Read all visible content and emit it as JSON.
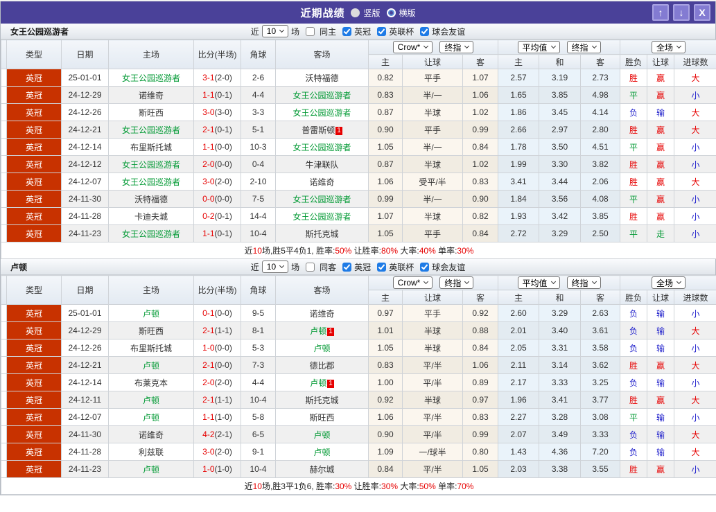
{
  "titlebar": {
    "title": "近期战绩",
    "radio_vertical": "竖版",
    "radio_horizontal": "横版"
  },
  "icons": {
    "up": "↑",
    "down": "↓",
    "close": "X",
    "chevron": "v"
  },
  "colors": {
    "titlebar_purple": "#4a4199",
    "titlebar_button": "#837bd2",
    "league_badge": "#c83200",
    "result_red": "#e60000",
    "result_green": "#009933",
    "result_blue": "#2222cc",
    "checkbox_blue": "#1e7be6",
    "team_green": "#009933"
  },
  "headers": {
    "main": [
      "类型",
      "日期",
      "主场",
      "比分(半场)",
      "角球",
      "客场"
    ],
    "sub": [
      "主",
      "让球",
      "客",
      "主",
      "和",
      "客",
      "胜负",
      "让球",
      "进球数"
    ]
  },
  "controls": {
    "company": "Crow*",
    "stage": "终指",
    "average": "平均值",
    "stage2": "终指",
    "scope": "全场"
  },
  "sections": [
    {
      "team": "女王公园巡游者",
      "filter": {
        "near": "近",
        "count": "10",
        "games": "场",
        "same": "同主",
        "leagues": [
          "英冠",
          "英联杯",
          "球会友谊"
        ]
      },
      "rows": [
        {
          "lg": "英冠",
          "date": "25-01-01",
          "home": "女王公园巡游者",
          "hG": 1,
          "hCard": "",
          "score": "3-1",
          "half": "(2-0)",
          "cor": "2-6",
          "away": "沃特福德",
          "aG": 0,
          "aCard": "",
          "ho": "0.82",
          "line": "平手",
          "ao": "1.07",
          "ah": "2.57",
          "ad": "3.19",
          "aa": "2.73",
          "res": [
            "胜",
            "red"
          ],
          "let": [
            "赢",
            "red"
          ],
          "tg": [
            "大",
            "red"
          ]
        },
        {
          "lg": "英冠",
          "date": "24-12-29",
          "home": "诺维奇",
          "hG": 0,
          "hCard": "",
          "score": "1-1",
          "half": "(0-1)",
          "cor": "4-4",
          "away": "女王公园巡游者",
          "aG": 1,
          "aCard": "",
          "ho": "0.83",
          "line": "半/一",
          "ao": "1.06",
          "ah": "1.65",
          "ad": "3.85",
          "aa": "4.98",
          "res": [
            "平",
            "green"
          ],
          "let": [
            "赢",
            "red"
          ],
          "tg": [
            "小",
            "blue"
          ]
        },
        {
          "lg": "英冠",
          "date": "24-12-26",
          "home": "斯旺西",
          "hG": 0,
          "hCard": "",
          "score": "3-0",
          "half": "(3-0)",
          "cor": "3-3",
          "away": "女王公园巡游者",
          "aG": 1,
          "aCard": "",
          "ho": "0.87",
          "line": "半球",
          "ao": "1.02",
          "ah": "1.86",
          "ad": "3.45",
          "aa": "4.14",
          "res": [
            "负",
            "blue"
          ],
          "let": [
            "输",
            "blue"
          ],
          "tg": [
            "大",
            "red"
          ]
        },
        {
          "lg": "英冠",
          "date": "24-12-21",
          "home": "女王公园巡游者",
          "hG": 1,
          "hCard": "",
          "score": "2-1",
          "half": "(0-1)",
          "cor": "5-1",
          "away": "普雷斯顿",
          "aG": 0,
          "aCard": "1",
          "ho": "0.90",
          "line": "平手",
          "ao": "0.99",
          "ah": "2.66",
          "ad": "2.97",
          "aa": "2.80",
          "res": [
            "胜",
            "red"
          ],
          "let": [
            "赢",
            "red"
          ],
          "tg": [
            "大",
            "red"
          ]
        },
        {
          "lg": "英冠",
          "date": "24-12-14",
          "home": "布里斯托城",
          "hG": 0,
          "hCard": "",
          "score": "1-1",
          "half": "(0-0)",
          "cor": "10-3",
          "away": "女王公园巡游者",
          "aG": 1,
          "aCard": "",
          "ho": "1.05",
          "line": "半/一",
          "ao": "0.84",
          "ah": "1.78",
          "ad": "3.50",
          "aa": "4.51",
          "res": [
            "平",
            "green"
          ],
          "let": [
            "赢",
            "red"
          ],
          "tg": [
            "小",
            "blue"
          ]
        },
        {
          "lg": "英冠",
          "date": "24-12-12",
          "home": "女王公园巡游者",
          "hG": 1,
          "hCard": "",
          "score": "2-0",
          "half": "(0-0)",
          "cor": "0-4",
          "away": "牛津联队",
          "aG": 0,
          "aCard": "",
          "ho": "0.87",
          "line": "半球",
          "ao": "1.02",
          "ah": "1.99",
          "ad": "3.30",
          "aa": "3.82",
          "res": [
            "胜",
            "red"
          ],
          "let": [
            "赢",
            "red"
          ],
          "tg": [
            "小",
            "blue"
          ]
        },
        {
          "lg": "英冠",
          "date": "24-12-07",
          "home": "女王公园巡游者",
          "hG": 1,
          "hCard": "",
          "score": "3-0",
          "half": "(2-0)",
          "cor": "2-10",
          "away": "诺维奇",
          "aG": 0,
          "aCard": "",
          "ho": "1.06",
          "line": "受平/半",
          "ao": "0.83",
          "ah": "3.41",
          "ad": "3.44",
          "aa": "2.06",
          "res": [
            "胜",
            "red"
          ],
          "let": [
            "赢",
            "red"
          ],
          "tg": [
            "大",
            "red"
          ]
        },
        {
          "lg": "英冠",
          "date": "24-11-30",
          "home": "沃特福德",
          "hG": 0,
          "hCard": "",
          "score": "0-0",
          "half": "(0-0)",
          "cor": "7-5",
          "away": "女王公园巡游者",
          "aG": 1,
          "aCard": "",
          "ho": "0.99",
          "line": "半/一",
          "ao": "0.90",
          "ah": "1.84",
          "ad": "3.56",
          "aa": "4.08",
          "res": [
            "平",
            "green"
          ],
          "let": [
            "赢",
            "red"
          ],
          "tg": [
            "小",
            "blue"
          ]
        },
        {
          "lg": "英冠",
          "date": "24-11-28",
          "home": "卡迪夫城",
          "hG": 0,
          "hCard": "",
          "score": "0-2",
          "half": "(0-1)",
          "cor": "14-4",
          "away": "女王公园巡游者",
          "aG": 1,
          "aCard": "",
          "ho": "1.07",
          "line": "半球",
          "ao": "0.82",
          "ah": "1.93",
          "ad": "3.42",
          "aa": "3.85",
          "res": [
            "胜",
            "red"
          ],
          "let": [
            "赢",
            "red"
          ],
          "tg": [
            "小",
            "blue"
          ]
        },
        {
          "lg": "英冠",
          "date": "24-11-23",
          "home": "女王公园巡游者",
          "hG": 1,
          "hCard": "",
          "score": "1-1",
          "half": "(0-1)",
          "cor": "10-4",
          "away": "斯托克城",
          "aG": 0,
          "aCard": "",
          "ho": "1.05",
          "line": "平手",
          "ao": "0.84",
          "ah": "2.72",
          "ad": "3.29",
          "aa": "2.50",
          "res": [
            "平",
            "green"
          ],
          "let": [
            "走",
            "green"
          ],
          "tg": [
            "小",
            "blue"
          ]
        }
      ],
      "summary": [
        [
          "近",
          0
        ],
        [
          "10",
          1
        ],
        [
          "场,胜5平4负1, 胜率:",
          0
        ],
        [
          "50%",
          1
        ],
        [
          " 让胜率:",
          0
        ],
        [
          "80%",
          1
        ],
        [
          " 大率:",
          0
        ],
        [
          "40%",
          1
        ],
        [
          " 单率:",
          0
        ],
        [
          "30%",
          1
        ]
      ]
    },
    {
      "team": "卢顿",
      "filter": {
        "near": "近",
        "count": "10",
        "games": "场",
        "same": "同客",
        "leagues": [
          "英冠",
          "英联杯",
          "球会友谊"
        ]
      },
      "rows": [
        {
          "lg": "英冠",
          "date": "25-01-01",
          "home": "卢顿",
          "hG": 1,
          "hCard": "",
          "score": "0-1",
          "half": "(0-0)",
          "cor": "9-5",
          "away": "诺维奇",
          "aG": 0,
          "aCard": "",
          "ho": "0.97",
          "line": "平手",
          "ao": "0.92",
          "ah": "2.60",
          "ad": "3.29",
          "aa": "2.63",
          "res": [
            "负",
            "blue"
          ],
          "let": [
            "输",
            "blue"
          ],
          "tg": [
            "小",
            "blue"
          ]
        },
        {
          "lg": "英冠",
          "date": "24-12-29",
          "home": "斯旺西",
          "hG": 0,
          "hCard": "",
          "score": "2-1",
          "half": "(1-1)",
          "cor": "8-1",
          "away": "卢顿",
          "aG": 1,
          "aCard": "1",
          "ho": "1.01",
          "line": "半球",
          "ao": "0.88",
          "ah": "2.01",
          "ad": "3.40",
          "aa": "3.61",
          "res": [
            "负",
            "blue"
          ],
          "let": [
            "输",
            "blue"
          ],
          "tg": [
            "大",
            "red"
          ]
        },
        {
          "lg": "英冠",
          "date": "24-12-26",
          "home": "布里斯托城",
          "hG": 0,
          "hCard": "",
          "score": "1-0",
          "half": "(0-0)",
          "cor": "5-3",
          "away": "卢顿",
          "aG": 1,
          "aCard": "",
          "ho": "1.05",
          "line": "半球",
          "ao": "0.84",
          "ah": "2.05",
          "ad": "3.31",
          "aa": "3.58",
          "res": [
            "负",
            "blue"
          ],
          "let": [
            "输",
            "blue"
          ],
          "tg": [
            "小",
            "blue"
          ]
        },
        {
          "lg": "英冠",
          "date": "24-12-21",
          "home": "卢顿",
          "hG": 1,
          "hCard": "",
          "score": "2-1",
          "half": "(0-0)",
          "cor": "7-3",
          "away": "德比郡",
          "aG": 0,
          "aCard": "",
          "ho": "0.83",
          "line": "平/半",
          "ao": "1.06",
          "ah": "2.11",
          "ad": "3.14",
          "aa": "3.62",
          "res": [
            "胜",
            "red"
          ],
          "let": [
            "赢",
            "red"
          ],
          "tg": [
            "大",
            "red"
          ]
        },
        {
          "lg": "英冠",
          "date": "24-12-14",
          "home": "布莱克本",
          "hG": 0,
          "hCard": "",
          "score": "2-0",
          "half": "(2-0)",
          "cor": "4-4",
          "away": "卢顿",
          "aG": 1,
          "aCard": "1",
          "ho": "1.00",
          "line": "平/半",
          "ao": "0.89",
          "ah": "2.17",
          "ad": "3.33",
          "aa": "3.25",
          "res": [
            "负",
            "blue"
          ],
          "let": [
            "输",
            "blue"
          ],
          "tg": [
            "小",
            "blue"
          ]
        },
        {
          "lg": "英冠",
          "date": "24-12-11",
          "home": "卢顿",
          "hG": 1,
          "hCard": "",
          "score": "2-1",
          "half": "(1-1)",
          "cor": "10-4",
          "away": "斯托克城",
          "aG": 0,
          "aCard": "",
          "ho": "0.92",
          "line": "半球",
          "ao": "0.97",
          "ah": "1.96",
          "ad": "3.41",
          "aa": "3.77",
          "res": [
            "胜",
            "red"
          ],
          "let": [
            "赢",
            "red"
          ],
          "tg": [
            "大",
            "red"
          ]
        },
        {
          "lg": "英冠",
          "date": "24-12-07",
          "home": "卢顿",
          "hG": 1,
          "hCard": "",
          "score": "1-1",
          "half": "(1-0)",
          "cor": "5-8",
          "away": "斯旺西",
          "aG": 0,
          "aCard": "",
          "ho": "1.06",
          "line": "平/半",
          "ao": "0.83",
          "ah": "2.27",
          "ad": "3.28",
          "aa": "3.08",
          "res": [
            "平",
            "green"
          ],
          "let": [
            "输",
            "blue"
          ],
          "tg": [
            "小",
            "blue"
          ]
        },
        {
          "lg": "英冠",
          "date": "24-11-30",
          "home": "诺维奇",
          "hG": 0,
          "hCard": "",
          "score": "4-2",
          "half": "(2-1)",
          "cor": "6-5",
          "away": "卢顿",
          "aG": 1,
          "aCard": "",
          "ho": "0.90",
          "line": "平/半",
          "ao": "0.99",
          "ah": "2.07",
          "ad": "3.49",
          "aa": "3.33",
          "res": [
            "负",
            "blue"
          ],
          "let": [
            "输",
            "blue"
          ],
          "tg": [
            "大",
            "red"
          ]
        },
        {
          "lg": "英冠",
          "date": "24-11-28",
          "home": "利兹联",
          "hG": 0,
          "hCard": "",
          "score": "3-0",
          "half": "(2-0)",
          "cor": "9-1",
          "away": "卢顿",
          "aG": 1,
          "aCard": "",
          "ho": "1.09",
          "line": "一/球半",
          "ao": "0.80",
          "ah": "1.43",
          "ad": "4.36",
          "aa": "7.20",
          "res": [
            "负",
            "blue"
          ],
          "let": [
            "输",
            "blue"
          ],
          "tg": [
            "大",
            "red"
          ]
        },
        {
          "lg": "英冠",
          "date": "24-11-23",
          "home": "卢顿",
          "hG": 1,
          "hCard": "",
          "score": "1-0",
          "half": "(1-0)",
          "cor": "10-4",
          "away": "赫尔城",
          "aG": 0,
          "aCard": "",
          "ho": "0.84",
          "line": "平/半",
          "ao": "1.05",
          "ah": "2.03",
          "ad": "3.38",
          "aa": "3.55",
          "res": [
            "胜",
            "red"
          ],
          "let": [
            "赢",
            "red"
          ],
          "tg": [
            "小",
            "blue"
          ]
        }
      ],
      "summary": [
        [
          "近",
          0
        ],
        [
          "10",
          1
        ],
        [
          "场,胜3平1负6, 胜率:",
          0
        ],
        [
          "30%",
          1
        ],
        [
          " 让胜率:",
          0
        ],
        [
          "30%",
          1
        ],
        [
          " 大率:",
          0
        ],
        [
          "50%",
          1
        ],
        [
          " 单率:",
          0
        ],
        [
          "70%",
          1
        ]
      ]
    }
  ]
}
